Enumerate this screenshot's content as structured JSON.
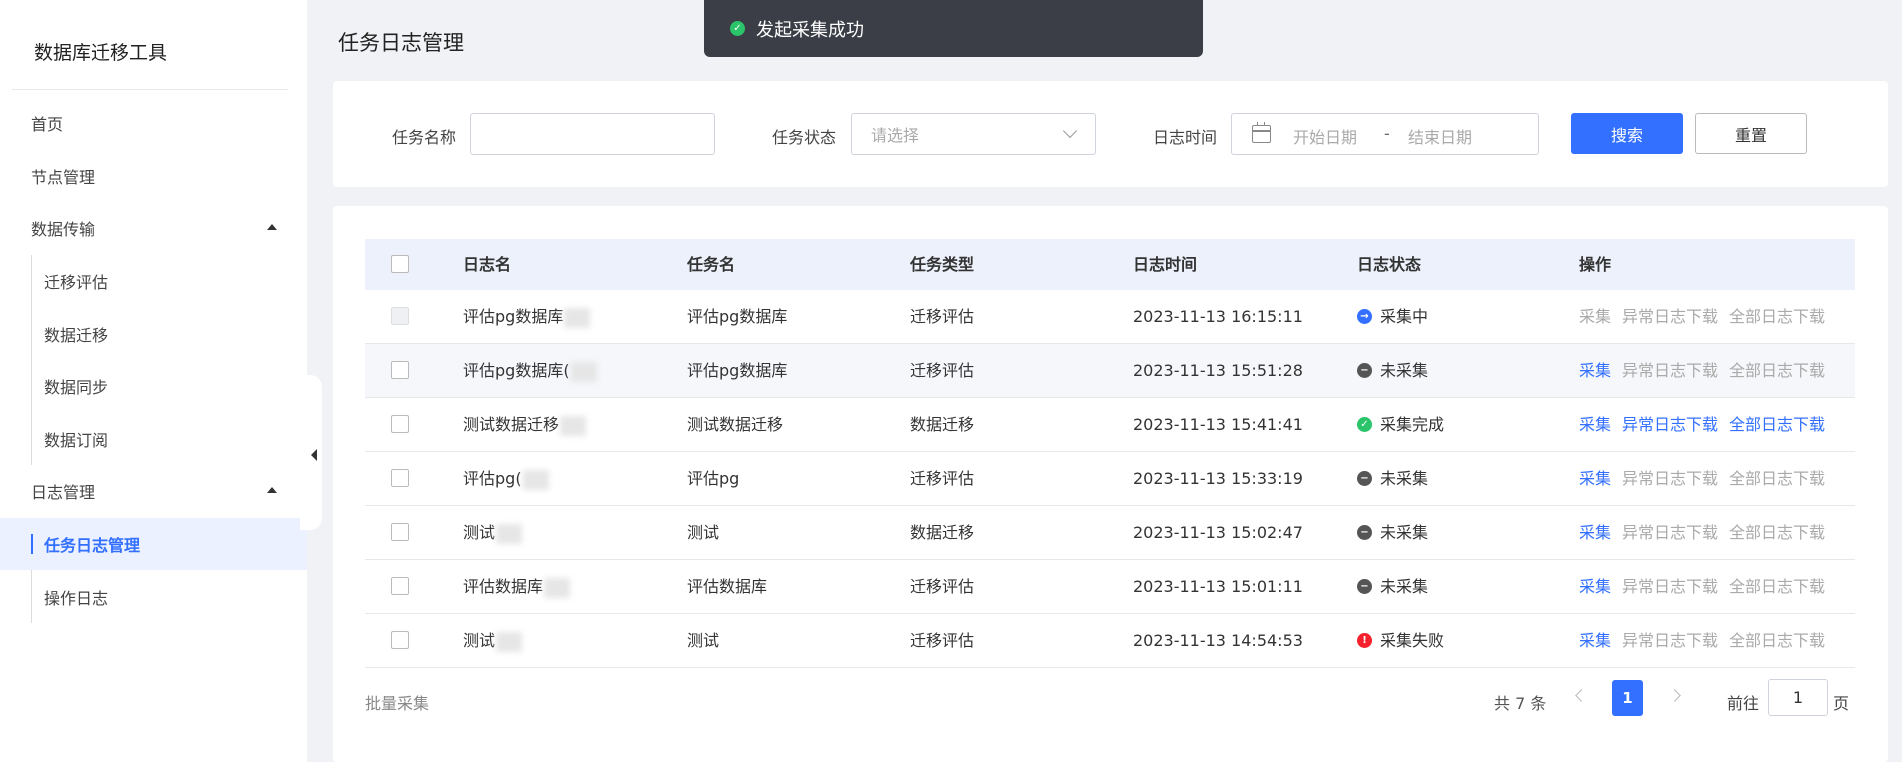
{
  "app": {
    "title": "数据库迁移工具"
  },
  "sidebar": {
    "items": [
      {
        "label": "首页",
        "type": "top"
      },
      {
        "label": "节点管理",
        "type": "top"
      },
      {
        "label": "数据传输",
        "type": "top",
        "expanded": true
      },
      {
        "label": "迁移评估",
        "type": "sub"
      },
      {
        "label": "数据迁移",
        "type": "sub"
      },
      {
        "label": "数据同步",
        "type": "sub"
      },
      {
        "label": "数据订阅",
        "type": "sub"
      },
      {
        "label": "日志管理",
        "type": "top",
        "expanded": true
      },
      {
        "label": "任务日志管理",
        "type": "sub",
        "active": true
      },
      {
        "label": "操作日志",
        "type": "sub"
      }
    ]
  },
  "page": {
    "title": "任务日志管理"
  },
  "toast": {
    "message": "发起采集成功",
    "icon": "check-circle-icon",
    "color": "#2bc46a"
  },
  "filters": {
    "task_name_label": "任务名称",
    "task_name_value": "",
    "task_status_label": "任务状态",
    "task_status_placeholder": "请选择",
    "log_time_label": "日志时间",
    "start_placeholder": "开始日期",
    "separator": "-",
    "end_placeholder": "结束日期",
    "search_label": "搜索",
    "reset_label": "重置"
  },
  "table": {
    "columns": [
      "日志名",
      "任务名",
      "任务类型",
      "日志时间",
      "日志状态",
      "操作"
    ],
    "actions": [
      "采集",
      "异常日志下载",
      "全部日志下载"
    ],
    "rows": [
      {
        "log_name": "评估pg数据库",
        "task_name": "评估pg数据库",
        "task_type": "迁移评估",
        "log_time": "2023-11-13 16:15:11",
        "status": "采集中",
        "status_kind": "collecting",
        "disabled": true,
        "collect_on": false,
        "error_dl_on": false,
        "all_dl_on": false,
        "highlight": false
      },
      {
        "log_name": "评估pg数据库(",
        "task_name": "评估pg数据库",
        "task_type": "迁移评估",
        "log_time": "2023-11-13 15:51:28",
        "status": "未采集",
        "status_kind": "none",
        "disabled": false,
        "collect_on": true,
        "error_dl_on": false,
        "all_dl_on": false,
        "highlight": true
      },
      {
        "log_name": "测试数据迁移",
        "task_name": "测试数据迁移",
        "task_type": "数据迁移",
        "log_time": "2023-11-13 15:41:41",
        "status": "采集完成",
        "status_kind": "done",
        "disabled": false,
        "collect_on": true,
        "error_dl_on": true,
        "all_dl_on": true,
        "highlight": false
      },
      {
        "log_name": "评估pg(",
        "task_name": "评估pg",
        "task_type": "迁移评估",
        "log_time": "2023-11-13 15:33:19",
        "status": "未采集",
        "status_kind": "none",
        "disabled": false,
        "collect_on": true,
        "error_dl_on": false,
        "all_dl_on": false,
        "highlight": false
      },
      {
        "log_name": "测试",
        "task_name": "测试",
        "task_type": "数据迁移",
        "log_time": "2023-11-13 15:02:47",
        "status": "未采集",
        "status_kind": "none",
        "disabled": false,
        "collect_on": true,
        "error_dl_on": false,
        "all_dl_on": false,
        "highlight": false
      },
      {
        "log_name": "评估数据库",
        "task_name": "评估数据库",
        "task_type": "迁移评估",
        "log_time": "2023-11-13 15:01:11",
        "status": "未采集",
        "status_kind": "none",
        "disabled": false,
        "collect_on": true,
        "error_dl_on": false,
        "all_dl_on": false,
        "highlight": false
      },
      {
        "log_name": "测试",
        "task_name": "测试",
        "task_type": "迁移评估",
        "log_time": "2023-11-13 14:54:53",
        "status": "采集失败",
        "status_kind": "failed",
        "disabled": false,
        "collect_on": true,
        "error_dl_on": false,
        "all_dl_on": false,
        "highlight": false
      }
    ]
  },
  "status_styles": {
    "collecting": {
      "icon": "arrow-right-circle-icon",
      "color": "#3370ff",
      "glyph": "→"
    },
    "none": {
      "icon": "minus-circle-icon",
      "color": "#555555",
      "glyph": "−"
    },
    "done": {
      "icon": "check-circle-icon",
      "color": "#2bc46a",
      "glyph": "✓"
    },
    "failed": {
      "icon": "exclamation-circle-icon",
      "color": "#f5222d",
      "glyph": "!"
    }
  },
  "footer": {
    "batch_label": "批量采集",
    "total_text": "共 7 条",
    "current_page": "1",
    "goto_label": "前往",
    "goto_value": "1",
    "page_suffix": "页"
  },
  "colors": {
    "accent": "#3370ff",
    "active_bg": "#ebf1fe",
    "header_bg": "#edf1fb"
  }
}
